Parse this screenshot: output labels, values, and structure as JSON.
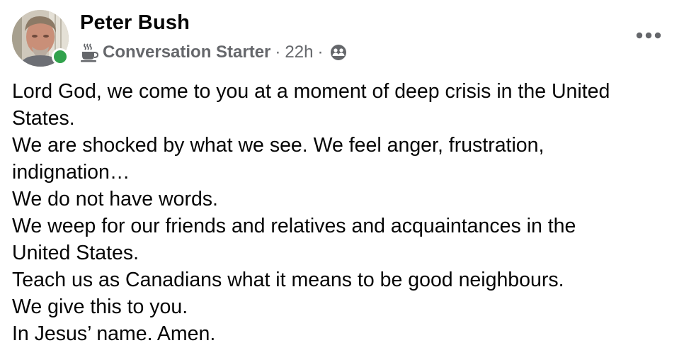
{
  "post": {
    "author_name": "Peter Bush",
    "online_status": "online",
    "badge": {
      "label": "Conversation Starter",
      "icon": "coffee-cup-icon"
    },
    "timestamp": "22h",
    "separator": "·",
    "audience_icon": "friends-audience-icon",
    "more_icon": "more-options-icon",
    "message_lines": [
      "Lord God, we come to you at a moment of deep crisis in the United",
      "States.",
      "We are shocked by what we see. We feel anger, frustration,",
      "indignation…",
      "We do not have words.",
      "We weep for our friends and relatives and acquaintances in the",
      "United States.",
      "Teach us as Canadians what it means to be good neighbours.",
      "We give this to you.",
      "In Jesus’ name. Amen."
    ]
  },
  "colors": {
    "text_primary": "#050505",
    "text_secondary": "#65676b",
    "online_green": "#31a24c",
    "background": "#ffffff"
  }
}
